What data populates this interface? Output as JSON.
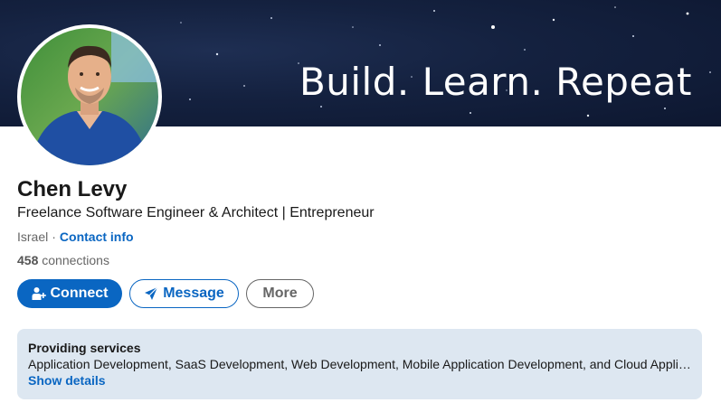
{
  "banner": {
    "text": "Build.  Learn.  Repeat"
  },
  "profile": {
    "name": "Chen Levy",
    "headline": "Freelance Software Engineer & Architect | Entrepreneur",
    "location": "Israel",
    "separator": "·",
    "contact_info_label": "Contact info",
    "connections_count": "458",
    "connections_label": "connections"
  },
  "actions": {
    "connect_label": "Connect",
    "message_label": "Message",
    "more_label": "More"
  },
  "services": {
    "title": "Providing services",
    "list": "Application Development, SaaS Development, Web Development, Mobile Application Development, and Cloud Application Development",
    "show_details_label": "Show details"
  },
  "icons": {
    "connect": "add-person-icon",
    "message": "paper-plane-icon"
  },
  "colors": {
    "primary": "#0a66c2",
    "services_bg": "#dde7f1",
    "banner_bg": "#14213f"
  }
}
